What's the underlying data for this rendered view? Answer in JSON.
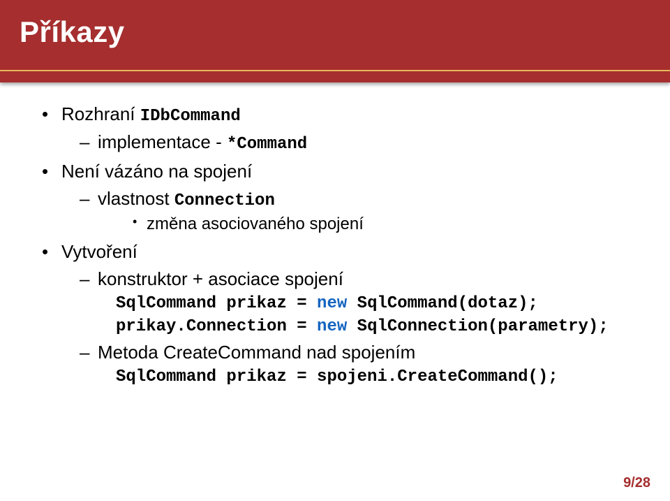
{
  "title": "Příkazy",
  "bullets": {
    "b1_prefix": "Rozhraní ",
    "b1_code": "IDbCommand",
    "b1_sub1_prefix": "implementace - ",
    "b1_sub1_code": "*Command",
    "b2": "Není vázáno na spojení",
    "b2_sub1_prefix": "vlastnost ",
    "b2_sub1_code": "Connection",
    "b2_sub1_l3": "změna asociovaného spojení",
    "b3": "Vytvoření",
    "b3_sub1": "konstruktor + asociace spojení",
    "b3_code1_a": "SqlCommand prikaz = ",
    "b3_code1_kw": "new",
    "b3_code1_b": " SqlCommand(dotaz);",
    "b3_code2_a": "prikay.Connection = ",
    "b3_code2_kw": "new",
    "b3_code2_b": " SqlConnection(parametry);",
    "b3_sub2": "Metoda CreateCommand nad spojením",
    "b3_code3": "SqlCommand prikaz = spojeni.CreateCommand();"
  },
  "page": "9/28"
}
